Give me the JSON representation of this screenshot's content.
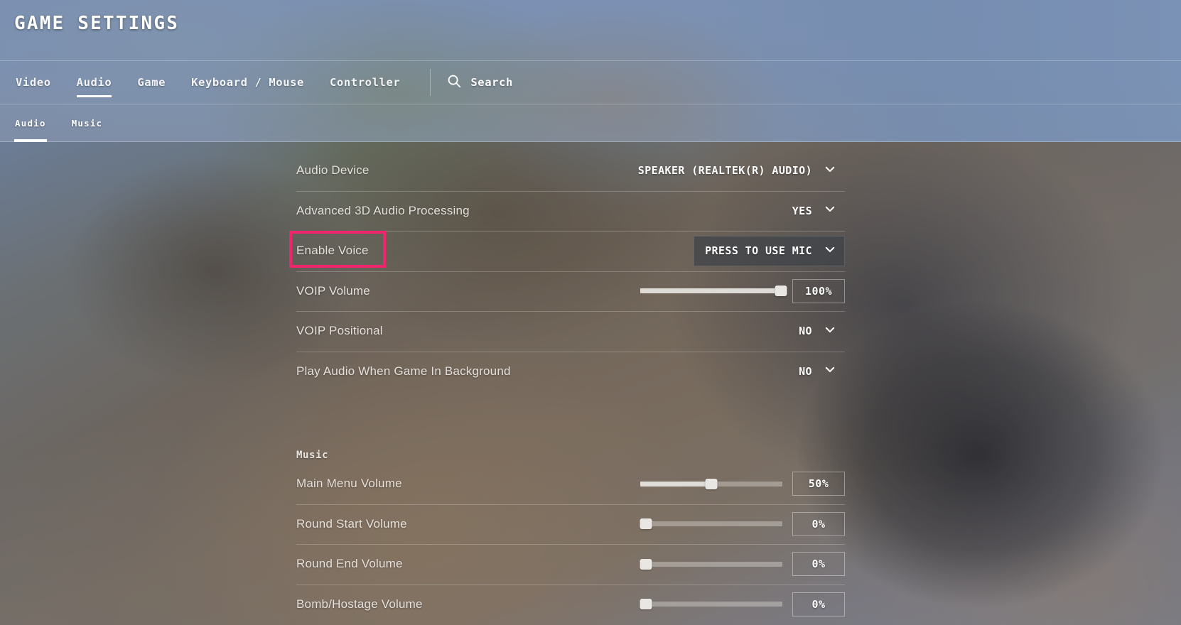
{
  "header": {
    "title": "GAME SETTINGS"
  },
  "nav": {
    "items": [
      {
        "label": "Video",
        "active": false
      },
      {
        "label": "Audio",
        "active": true
      },
      {
        "label": "Game",
        "active": false
      },
      {
        "label": "Keyboard / Mouse",
        "active": false
      },
      {
        "label": "Controller",
        "active": false
      }
    ],
    "search": {
      "label": "Search",
      "icon": "search-icon"
    }
  },
  "subnav": {
    "items": [
      {
        "label": "Audio",
        "active": true
      },
      {
        "label": "Music",
        "active": false
      }
    ]
  },
  "settings": {
    "audio_rows": [
      {
        "label": "Audio Device",
        "control": "dropdown",
        "value": "SPEAKER (REALTEK(R) AUDIO)",
        "hovered": false
      },
      {
        "label": "Advanced 3D Audio Processing",
        "control": "dropdown",
        "value": "YES",
        "hovered": false
      },
      {
        "label": "Enable Voice",
        "control": "dropdown",
        "value": "PRESS TO USE MIC",
        "hovered": true
      },
      {
        "label": "VOIP Volume",
        "control": "slider",
        "value": "100%",
        "percent": 100
      },
      {
        "label": "VOIP Positional",
        "control": "dropdown",
        "value": "NO",
        "hovered": false
      },
      {
        "label": "Play Audio When Game In Background",
        "control": "dropdown",
        "value": "NO",
        "hovered": false
      }
    ],
    "music_section_label": "Music",
    "music_rows": [
      {
        "label": "Main Menu Volume",
        "control": "slider",
        "value": "50%",
        "percent": 50
      },
      {
        "label": "Round Start Volume",
        "control": "slider",
        "value": "0%",
        "percent": 0
      },
      {
        "label": "Round End Volume",
        "control": "slider",
        "value": "0%",
        "percent": 0
      },
      {
        "label": "Bomb/Hostage Volume",
        "control": "slider",
        "value": "0%",
        "percent": 0
      }
    ]
  },
  "annotation": {
    "target": "Enable Voice",
    "color": "#f0256e"
  }
}
